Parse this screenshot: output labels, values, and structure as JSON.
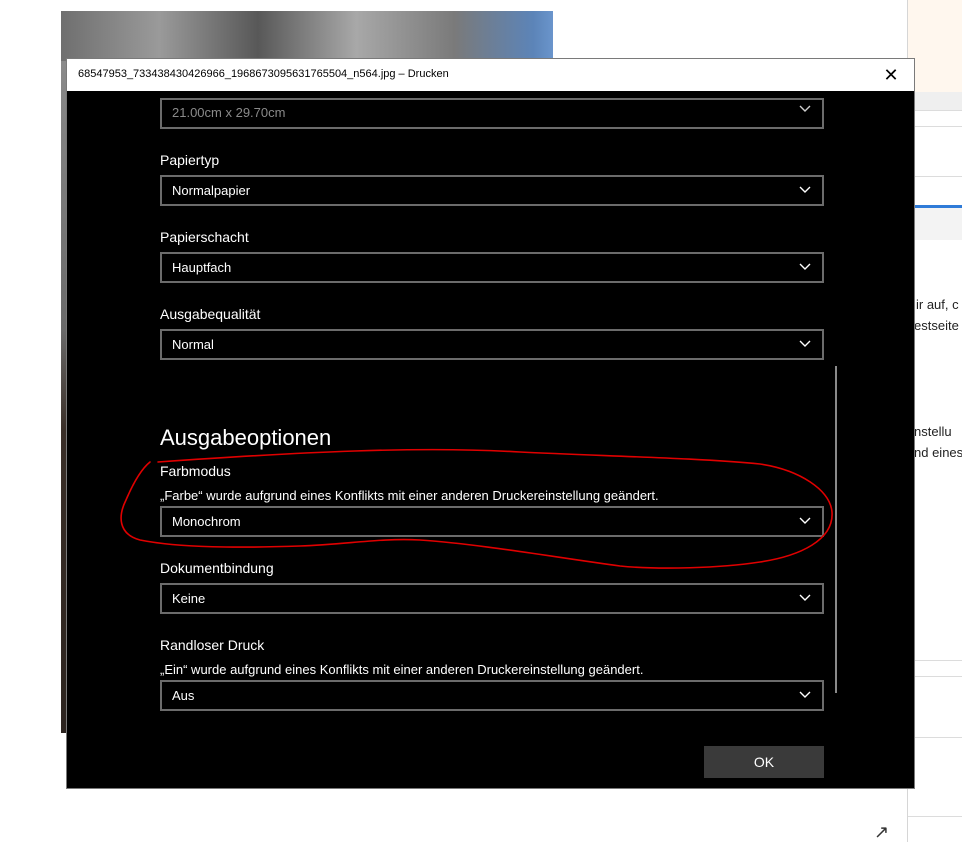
{
  "background": {
    "right_text_1": "ir auf, c",
    "right_text_2": "estseite",
    "right_text_3": "nstellu",
    "right_text_4": "nd eines"
  },
  "dialog": {
    "title": "68547953_733438430426966_1968673095631765504_n564.jpg – Drucken",
    "close_symbol": "✕",
    "paper_size": {
      "value": "21.00cm x 29.70cm"
    },
    "paper_type": {
      "label": "Papiertyp",
      "value": "Normalpapier"
    },
    "paper_tray": {
      "label": "Papierschacht",
      "value": "Hauptfach"
    },
    "output_quality": {
      "label": "Ausgabequalität",
      "value": "Normal"
    },
    "section_heading": "Ausgabeoptionen",
    "color_mode": {
      "label": "Farbmodus",
      "note": "„Farbe“ wurde aufgrund eines Konflikts mit einer anderen Druckereinstellung geändert.",
      "value": "Monochrom"
    },
    "binding": {
      "label": "Dokumentbindung",
      "value": "Keine"
    },
    "borderless": {
      "label": "Randloser Druck",
      "note": "„Ein“ wurde aufgrund eines Konflikts mit einer anderen Druckereinstellung geändert.",
      "value": "Aus"
    },
    "ok_label": "OK"
  },
  "colors": {
    "dialog_bg": "#000000",
    "field_border": "#6b6b6b",
    "annotation_red": "#e00000",
    "ok_button_bg": "#3a3a3a"
  },
  "icons": {
    "dropdown": "chevron-down-icon",
    "close": "close-icon",
    "expand": "expand-arrow-icon"
  }
}
